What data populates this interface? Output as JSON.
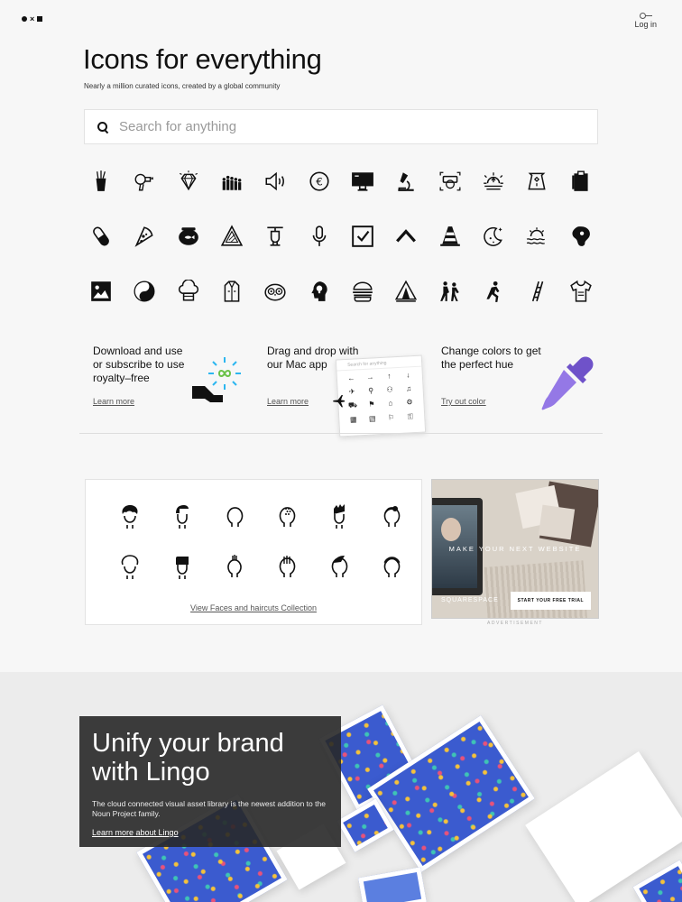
{
  "header": {
    "logo_x": "×",
    "login_label": "Log in"
  },
  "hero": {
    "title": "Icons for everything",
    "subtitle": "Nearly a million curated icons, created by a global community"
  },
  "search": {
    "placeholder": "Search for anything"
  },
  "icon_grid": [
    "noodle-box-icon",
    "hair-dryer-icon",
    "diamond-icon",
    "crowd-icon",
    "speaker-icon",
    "euro-coin-icon",
    "monitor-icon",
    "microscope-icon",
    "vr-headset-icon",
    "sunrise-icon",
    "sack-icon",
    "clipboard-icon",
    "pill-icon",
    "pizza-icon",
    "fishbowl-icon",
    "warning-sign-icon",
    "helicopter-icon",
    "microphone-icon",
    "checkbox-icon",
    "caret-up-icon",
    "traffic-cone-icon",
    "moon-stars-icon",
    "sunset-waves-icon",
    "steak-icon",
    "image-icon",
    "yin-yang-icon",
    "chef-hat-icon",
    "coat-icon",
    "owl-icon",
    "head-idea-icon",
    "burger-icon",
    "tent-icon",
    "dancing-couple-icon",
    "running-man-icon",
    "ladder-icon",
    "t-shirt-icon"
  ],
  "features": [
    {
      "text": "Download and use or subscribe to use royalty–free",
      "link": "Learn more"
    },
    {
      "text": "Drag and drop with our Mac app",
      "link": "Learn more"
    },
    {
      "text": "Change colors to get the perfect hue",
      "link": "Try out color"
    }
  ],
  "mac_app": {
    "search_placeholder": "Search for anything",
    "glyphs": [
      "←",
      "→",
      "↑",
      "↓",
      "✈",
      "⚲",
      "⚇",
      "♫",
      "⛟",
      "⚑",
      "⌂",
      "⚙",
      "▦",
      "▤",
      "⚐",
      "⚿"
    ]
  },
  "collection": {
    "link": "View Faces and haircuts Collection",
    "faces": [
      "face-curly-icon",
      "face-quiff-icon",
      "face-bald-icon",
      "face-dotted-icon",
      "face-spiky-icon",
      "face-bun-icon",
      "face-curly-outline-icon",
      "face-flat-icon",
      "face-mohawk-icon",
      "face-striped-icon",
      "face-fringe-icon",
      "face-cap-icon"
    ]
  },
  "ad": {
    "tagline": "MAKE YOUR NEXT WEBSITE",
    "brand": "SQUARESPACE",
    "cta": "START YOUR FREE TRIAL",
    "label": "ADVERTISEMENT"
  },
  "lingo": {
    "title_line1": "Unify your brand",
    "title_line2": "with Lingo",
    "description": "The cloud connected visual asset library is the newest addition to the Noun Project family.",
    "link": "Learn more about Lingo"
  },
  "colors": {
    "accent_blue": "#3b5bcf",
    "dropper_purple": "#8b6cdc",
    "hand_icon_blue": "#2bb6f0",
    "infinity_green": "#6cc24a"
  }
}
